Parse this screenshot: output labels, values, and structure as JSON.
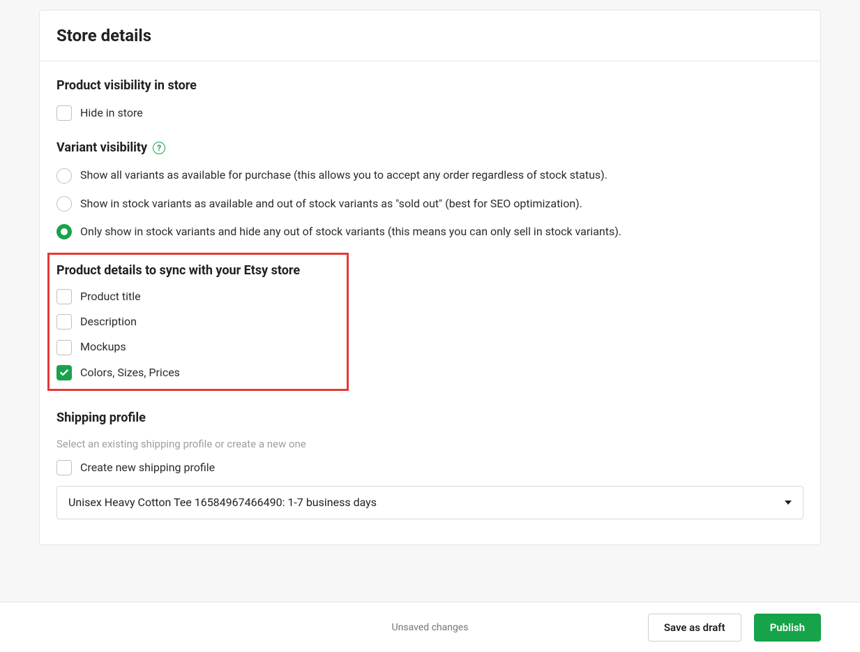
{
  "header": {
    "title": "Store details"
  },
  "visibility": {
    "title": "Product visibility in store",
    "hide_label": "Hide in store",
    "hide_checked": false
  },
  "variant": {
    "title": "Variant visibility",
    "options": [
      {
        "label": "Show all variants as available for purchase (this allows you to accept any order regardless of stock status).",
        "selected": false
      },
      {
        "label": "Show in stock variants as available and out of stock variants as \"sold out\" (best for SEO optimization).",
        "selected": false
      },
      {
        "label": "Only show in stock variants and hide any out of stock variants (this means you can only sell in stock variants).",
        "selected": true
      }
    ]
  },
  "sync": {
    "title": "Product details to sync with your Etsy store",
    "items": [
      {
        "label": "Product title",
        "checked": false
      },
      {
        "label": "Description",
        "checked": false
      },
      {
        "label": "Mockups",
        "checked": false
      },
      {
        "label": "Colors, Sizes, Prices",
        "checked": true
      }
    ]
  },
  "shipping": {
    "title": "Shipping profile",
    "helper": "Select an existing shipping profile or create a new one",
    "create_label": "Create new shipping profile",
    "create_checked": false,
    "selected": "Unisex Heavy Cotton Tee 16584967466490: 1-7 business days"
  },
  "footer": {
    "status": "Unsaved changes",
    "save_draft": "Save as draft",
    "publish": "Publish"
  }
}
